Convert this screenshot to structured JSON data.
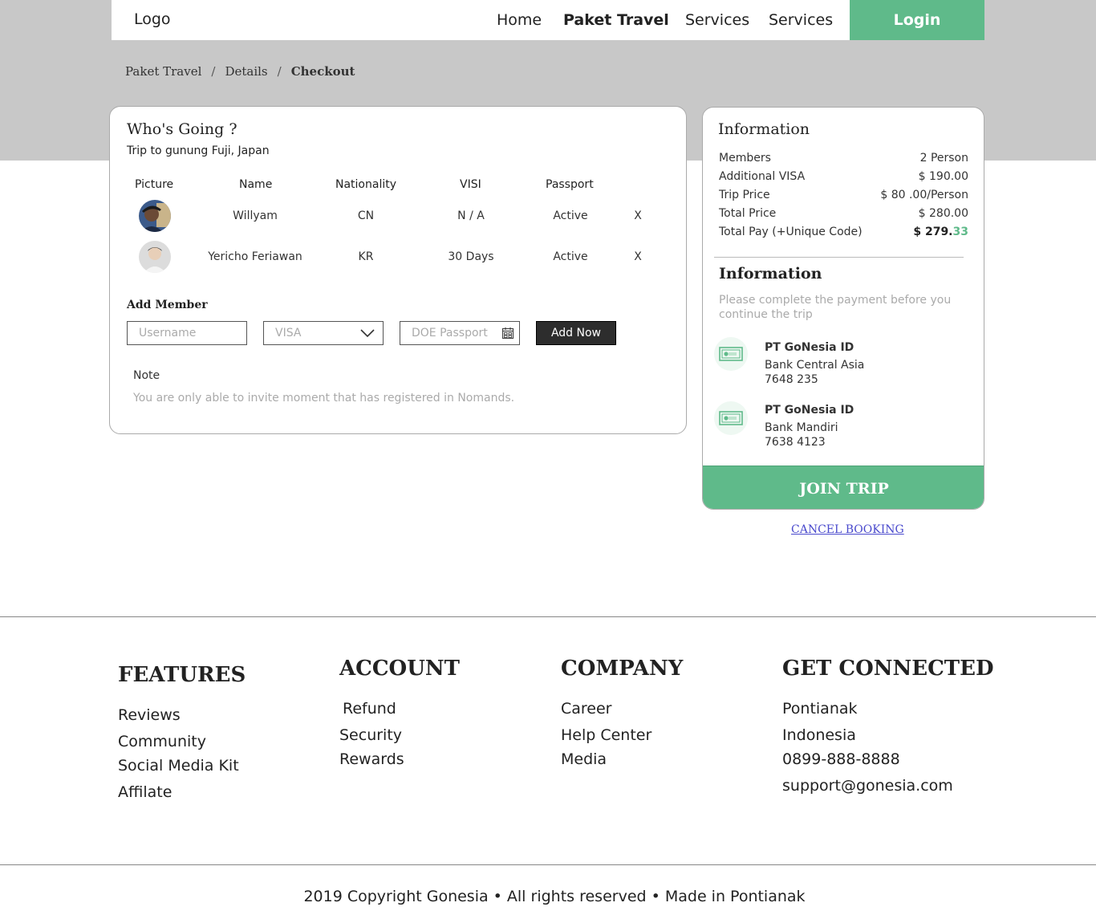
{
  "header": {
    "logo": "Logo",
    "nav": [
      "Home",
      "Paket Travel",
      "Services",
      "Services"
    ],
    "login_label": "Login"
  },
  "breadcrumb": {
    "items": [
      "Paket Travel",
      "Details",
      "Checkout"
    ],
    "separator": "/"
  },
  "whos_going": {
    "title": "Who's Going ?",
    "subtitle": "Trip to gunung Fuji, Japan",
    "columns": [
      "Picture",
      "Name",
      "Nationality",
      "VISI",
      "Passport"
    ],
    "rows": [
      {
        "name": "Willyam",
        "nationality": "CN",
        "visa": "N / A",
        "passport": "Active",
        "remove": "X"
      },
      {
        "name": "Yericho Feriawan",
        "nationality": "KR",
        "visa": "30 Days",
        "passport": "Active",
        "remove": "X"
      }
    ],
    "add_member_label": "Add Member",
    "username_placeholder": "Username",
    "visa_selected": "VISA",
    "passport_placeholder": "DOE Passport",
    "add_button": "Add Now",
    "note_label": "Note",
    "note_text": "You are only able  to invite moment that has registered in Nomands."
  },
  "information": {
    "title": "Information",
    "rows": [
      {
        "label": "Members",
        "value": "2 Person"
      },
      {
        "label": "Additional VISA",
        "value": "$ 190.00"
      },
      {
        "label": "Trip Price",
        "value": "$ 80 .00/Person"
      },
      {
        "label": "Total  Price",
        "value": "$ 280.00"
      }
    ],
    "total_pay_label": "Total  Pay (+Unique Code)",
    "total_pay_main": "$ 279.",
    "total_pay_code": "33",
    "payment_title": "Information",
    "payment_text": "Please complete the payment before you continue the trip",
    "banks": [
      {
        "company": "PT GoNesia ID",
        "bank": "Bank Central Asia",
        "account": "7648 235"
      },
      {
        "company": "PT GoNesia ID",
        "bank": "Bank Mandiri",
        "account": "7638 4123"
      }
    ],
    "join_button": "JOIN TRIP",
    "cancel_link": "CANCEL BOOKING"
  },
  "footer": {
    "features": {
      "title": "FEATURES",
      "links": [
        "Reviews",
        "Community",
        "Social Media Kit",
        "Affilate"
      ]
    },
    "account": {
      "title": "ACCOUNT",
      "links": [
        "Refund",
        "Security",
        "Rewards"
      ]
    },
    "company": {
      "title": "COMPANY",
      "links": [
        "Career",
        "Help Center",
        "Media"
      ]
    },
    "connected": {
      "title": "GET CONNECTED",
      "links": [
        "Pontianak",
        "Indonesia",
        "0899-888-8888",
        "support@gonesia.com"
      ]
    },
    "copyright": "2019 Copyright Gonesia • All rights reserved • Made in Pontianak"
  },
  "colors": {
    "accent": "#5fba8a",
    "band": "#c8c8c8",
    "link": "#4a4acd"
  }
}
